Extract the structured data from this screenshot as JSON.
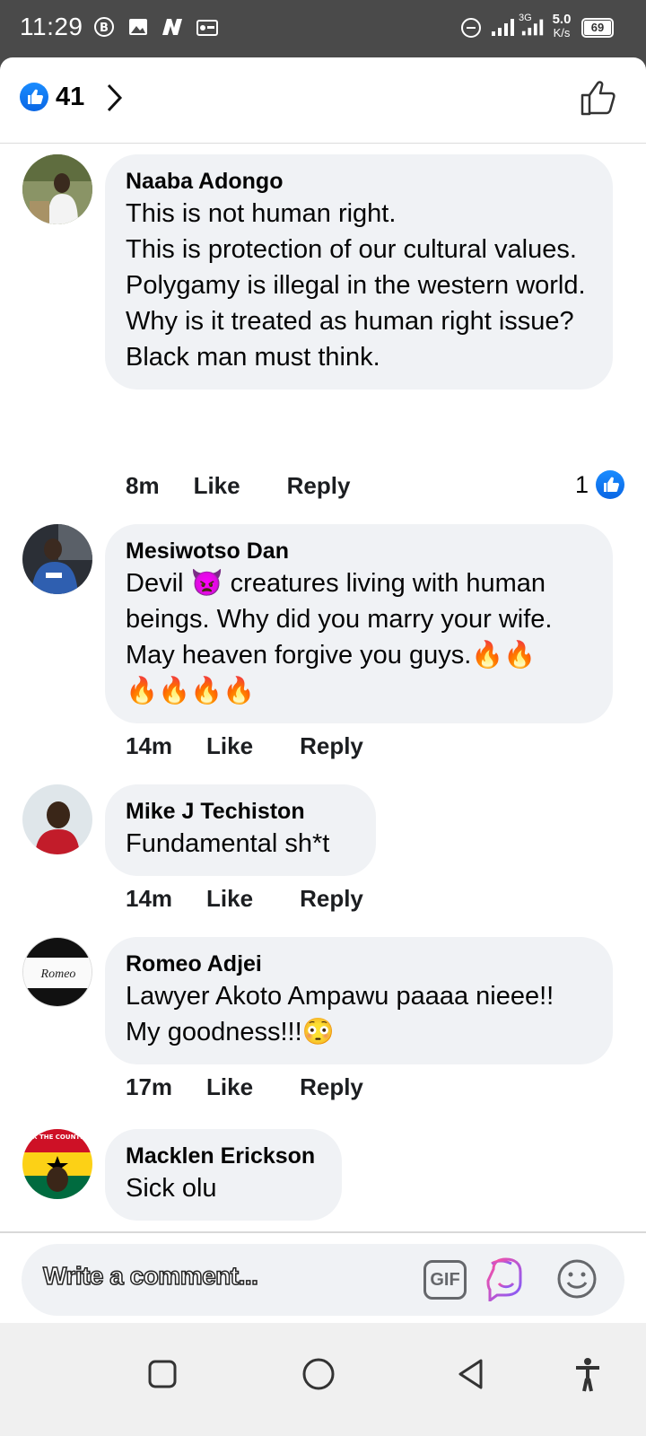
{
  "status_bar": {
    "time": "11:29",
    "network_speed": "5.0",
    "network_speed_unit": "K/s",
    "battery": "69",
    "signal_label": "3G"
  },
  "header": {
    "like_count": "41"
  },
  "comments": [
    {
      "author": "Naaba Adongo",
      "text": "This is not human right.\nThis is protection of our cultural values.\nPolygamy is illegal in the western world. Why is it treated as human right issue?\nBlack man must think.",
      "time": "8m",
      "like_label": "Like",
      "reply_label": "Reply",
      "reactions": "1"
    },
    {
      "author": "Mesiwotso Dan",
      "text": "Devil 👿 creatures living with human beings. Why did you marry your wife. May heaven forgive you guys.🔥🔥\n🔥🔥🔥🔥",
      "time": "14m",
      "like_label": "Like",
      "reply_label": "Reply"
    },
    {
      "author": "Mike J Techiston",
      "text": "Fundamental sh*t",
      "time": "14m",
      "like_label": "Like",
      "reply_label": "Reply"
    },
    {
      "author": "Romeo Adjei",
      "avatar_text": "Romeo",
      "text": "Lawyer Akoto Ampawu paaaa nieee!!\nMy goodness!!!😳",
      "time": "17m",
      "like_label": "Like",
      "reply_label": "Reply"
    },
    {
      "author": "Macklen Erickson",
      "avatar_text": "FIX THE COUNTRY",
      "text": "Sick olu",
      "time": "",
      "like_label": "",
      "reply_label": ""
    }
  ],
  "composer": {
    "placeholder": "Write a comment...",
    "gif_label": "GIF"
  },
  "colors": {
    "facebook_blue": "#1877f2",
    "bubble_bg": "#f0f2f5",
    "status_bar_bg": "#4a4a4a"
  }
}
